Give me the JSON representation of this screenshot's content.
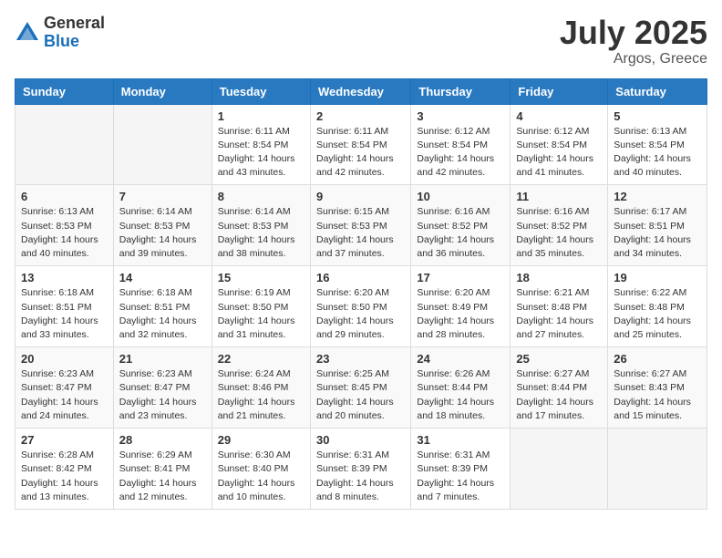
{
  "logo": {
    "general": "General",
    "blue": "Blue"
  },
  "title": {
    "month_year": "July 2025",
    "location": "Argos, Greece"
  },
  "weekdays": [
    "Sunday",
    "Monday",
    "Tuesday",
    "Wednesday",
    "Thursday",
    "Friday",
    "Saturday"
  ],
  "weeks": [
    [
      {
        "day": "",
        "sunrise": "",
        "sunset": "",
        "daylight": ""
      },
      {
        "day": "",
        "sunrise": "",
        "sunset": "",
        "daylight": ""
      },
      {
        "day": "1",
        "sunrise": "Sunrise: 6:11 AM",
        "sunset": "Sunset: 8:54 PM",
        "daylight": "Daylight: 14 hours and 43 minutes."
      },
      {
        "day": "2",
        "sunrise": "Sunrise: 6:11 AM",
        "sunset": "Sunset: 8:54 PM",
        "daylight": "Daylight: 14 hours and 42 minutes."
      },
      {
        "day": "3",
        "sunrise": "Sunrise: 6:12 AM",
        "sunset": "Sunset: 8:54 PM",
        "daylight": "Daylight: 14 hours and 42 minutes."
      },
      {
        "day": "4",
        "sunrise": "Sunrise: 6:12 AM",
        "sunset": "Sunset: 8:54 PM",
        "daylight": "Daylight: 14 hours and 41 minutes."
      },
      {
        "day": "5",
        "sunrise": "Sunrise: 6:13 AM",
        "sunset": "Sunset: 8:54 PM",
        "daylight": "Daylight: 14 hours and 40 minutes."
      }
    ],
    [
      {
        "day": "6",
        "sunrise": "Sunrise: 6:13 AM",
        "sunset": "Sunset: 8:53 PM",
        "daylight": "Daylight: 14 hours and 40 minutes."
      },
      {
        "day": "7",
        "sunrise": "Sunrise: 6:14 AM",
        "sunset": "Sunset: 8:53 PM",
        "daylight": "Daylight: 14 hours and 39 minutes."
      },
      {
        "day": "8",
        "sunrise": "Sunrise: 6:14 AM",
        "sunset": "Sunset: 8:53 PM",
        "daylight": "Daylight: 14 hours and 38 minutes."
      },
      {
        "day": "9",
        "sunrise": "Sunrise: 6:15 AM",
        "sunset": "Sunset: 8:53 PM",
        "daylight": "Daylight: 14 hours and 37 minutes."
      },
      {
        "day": "10",
        "sunrise": "Sunrise: 6:16 AM",
        "sunset": "Sunset: 8:52 PM",
        "daylight": "Daylight: 14 hours and 36 minutes."
      },
      {
        "day": "11",
        "sunrise": "Sunrise: 6:16 AM",
        "sunset": "Sunset: 8:52 PM",
        "daylight": "Daylight: 14 hours and 35 minutes."
      },
      {
        "day": "12",
        "sunrise": "Sunrise: 6:17 AM",
        "sunset": "Sunset: 8:51 PM",
        "daylight": "Daylight: 14 hours and 34 minutes."
      }
    ],
    [
      {
        "day": "13",
        "sunrise": "Sunrise: 6:18 AM",
        "sunset": "Sunset: 8:51 PM",
        "daylight": "Daylight: 14 hours and 33 minutes."
      },
      {
        "day": "14",
        "sunrise": "Sunrise: 6:18 AM",
        "sunset": "Sunset: 8:51 PM",
        "daylight": "Daylight: 14 hours and 32 minutes."
      },
      {
        "day": "15",
        "sunrise": "Sunrise: 6:19 AM",
        "sunset": "Sunset: 8:50 PM",
        "daylight": "Daylight: 14 hours and 31 minutes."
      },
      {
        "day": "16",
        "sunrise": "Sunrise: 6:20 AM",
        "sunset": "Sunset: 8:50 PM",
        "daylight": "Daylight: 14 hours and 29 minutes."
      },
      {
        "day": "17",
        "sunrise": "Sunrise: 6:20 AM",
        "sunset": "Sunset: 8:49 PM",
        "daylight": "Daylight: 14 hours and 28 minutes."
      },
      {
        "day": "18",
        "sunrise": "Sunrise: 6:21 AM",
        "sunset": "Sunset: 8:48 PM",
        "daylight": "Daylight: 14 hours and 27 minutes."
      },
      {
        "day": "19",
        "sunrise": "Sunrise: 6:22 AM",
        "sunset": "Sunset: 8:48 PM",
        "daylight": "Daylight: 14 hours and 25 minutes."
      }
    ],
    [
      {
        "day": "20",
        "sunrise": "Sunrise: 6:23 AM",
        "sunset": "Sunset: 8:47 PM",
        "daylight": "Daylight: 14 hours and 24 minutes."
      },
      {
        "day": "21",
        "sunrise": "Sunrise: 6:23 AM",
        "sunset": "Sunset: 8:47 PM",
        "daylight": "Daylight: 14 hours and 23 minutes."
      },
      {
        "day": "22",
        "sunrise": "Sunrise: 6:24 AM",
        "sunset": "Sunset: 8:46 PM",
        "daylight": "Daylight: 14 hours and 21 minutes."
      },
      {
        "day": "23",
        "sunrise": "Sunrise: 6:25 AM",
        "sunset": "Sunset: 8:45 PM",
        "daylight": "Daylight: 14 hours and 20 minutes."
      },
      {
        "day": "24",
        "sunrise": "Sunrise: 6:26 AM",
        "sunset": "Sunset: 8:44 PM",
        "daylight": "Daylight: 14 hours and 18 minutes."
      },
      {
        "day": "25",
        "sunrise": "Sunrise: 6:27 AM",
        "sunset": "Sunset: 8:44 PM",
        "daylight": "Daylight: 14 hours and 17 minutes."
      },
      {
        "day": "26",
        "sunrise": "Sunrise: 6:27 AM",
        "sunset": "Sunset: 8:43 PM",
        "daylight": "Daylight: 14 hours and 15 minutes."
      }
    ],
    [
      {
        "day": "27",
        "sunrise": "Sunrise: 6:28 AM",
        "sunset": "Sunset: 8:42 PM",
        "daylight": "Daylight: 14 hours and 13 minutes."
      },
      {
        "day": "28",
        "sunrise": "Sunrise: 6:29 AM",
        "sunset": "Sunset: 8:41 PM",
        "daylight": "Daylight: 14 hours and 12 minutes."
      },
      {
        "day": "29",
        "sunrise": "Sunrise: 6:30 AM",
        "sunset": "Sunset: 8:40 PM",
        "daylight": "Daylight: 14 hours and 10 minutes."
      },
      {
        "day": "30",
        "sunrise": "Sunrise: 6:31 AM",
        "sunset": "Sunset: 8:39 PM",
        "daylight": "Daylight: 14 hours and 8 minutes."
      },
      {
        "day": "31",
        "sunrise": "Sunrise: 6:31 AM",
        "sunset": "Sunset: 8:39 PM",
        "daylight": "Daylight: 14 hours and 7 minutes."
      },
      {
        "day": "",
        "sunrise": "",
        "sunset": "",
        "daylight": ""
      },
      {
        "day": "",
        "sunrise": "",
        "sunset": "",
        "daylight": ""
      }
    ]
  ]
}
